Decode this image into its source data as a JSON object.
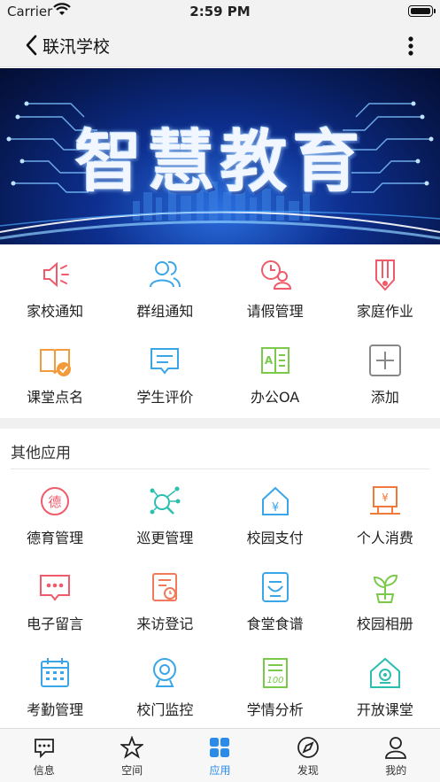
{
  "status_bar": {
    "carrier": "Carrier",
    "time": "2:59 PM"
  },
  "nav": {
    "title": "联汛学校",
    "back_icon": "chevron-left-icon",
    "more_icon": "more-vertical-icon"
  },
  "banner": {
    "slogan": "智慧教育"
  },
  "main_apps": [
    {
      "label": "家校通知",
      "icon": "speaker-icon",
      "color": "#f05a6a"
    },
    {
      "label": "群组通知",
      "icon": "group-icon",
      "color": "#3aa6e8"
    },
    {
      "label": "请假管理",
      "icon": "leave-clock-user-icon",
      "color": "#f05a6a"
    },
    {
      "label": "家庭作业",
      "icon": "homework-pencil-icon",
      "color": "#f05a6a"
    },
    {
      "label": "课堂点名",
      "icon": "book-check-icon",
      "color": "#f39a3a"
    },
    {
      "label": "学生评价",
      "icon": "comment-icon",
      "color": "#3aa6e8"
    },
    {
      "label": "办公OA",
      "icon": "office-id-card-icon",
      "color": "#7ac94a"
    },
    {
      "label": "添加",
      "icon": "add-icon",
      "color": "#888888"
    }
  ],
  "other_section": {
    "title": "其他应用"
  },
  "other_apps": [
    {
      "label": "德育管理",
      "icon": "moral-badge-icon",
      "color": "#f05a6a"
    },
    {
      "label": "巡更管理",
      "icon": "patrol-search-icon",
      "color": "#2bbfb0"
    },
    {
      "label": "校园支付",
      "icon": "campus-pay-icon",
      "color": "#3aa6e8"
    },
    {
      "label": "个人消费",
      "icon": "personal-spend-icon",
      "color": "#f07a3a"
    },
    {
      "label": "电子留言",
      "icon": "message-bubble-icon",
      "color": "#f05a6a"
    },
    {
      "label": "来访登记",
      "icon": "visitor-register-icon",
      "color": "#f07a5a"
    },
    {
      "label": "食堂食谱",
      "icon": "canteen-menu-icon",
      "color": "#3aa6e8"
    },
    {
      "label": "校园相册",
      "icon": "album-plant-icon",
      "color": "#7ac94a"
    },
    {
      "label": "考勤管理",
      "icon": "attendance-calendar-icon",
      "color": "#3aa6e8"
    },
    {
      "label": "校门监控",
      "icon": "gate-camera-icon",
      "color": "#3aa6e8"
    },
    {
      "label": "学情分析",
      "icon": "score-analysis-icon",
      "color": "#7ac94a"
    },
    {
      "label": "开放课堂",
      "icon": "open-class-icon",
      "color": "#2bbfb0"
    }
  ],
  "tabs": [
    {
      "label": "信息",
      "icon": "chat-icon",
      "active": false
    },
    {
      "label": "空间",
      "icon": "star-icon",
      "active": false
    },
    {
      "label": "应用",
      "icon": "apps-grid-icon",
      "active": true
    },
    {
      "label": "发现",
      "icon": "compass-icon",
      "active": false
    },
    {
      "label": "我的",
      "icon": "user-icon",
      "active": false
    }
  ],
  "colors": {
    "accent": "#2a8ce8",
    "nav_bg": "#f2f2f2",
    "separator": "#f0f0f0"
  }
}
